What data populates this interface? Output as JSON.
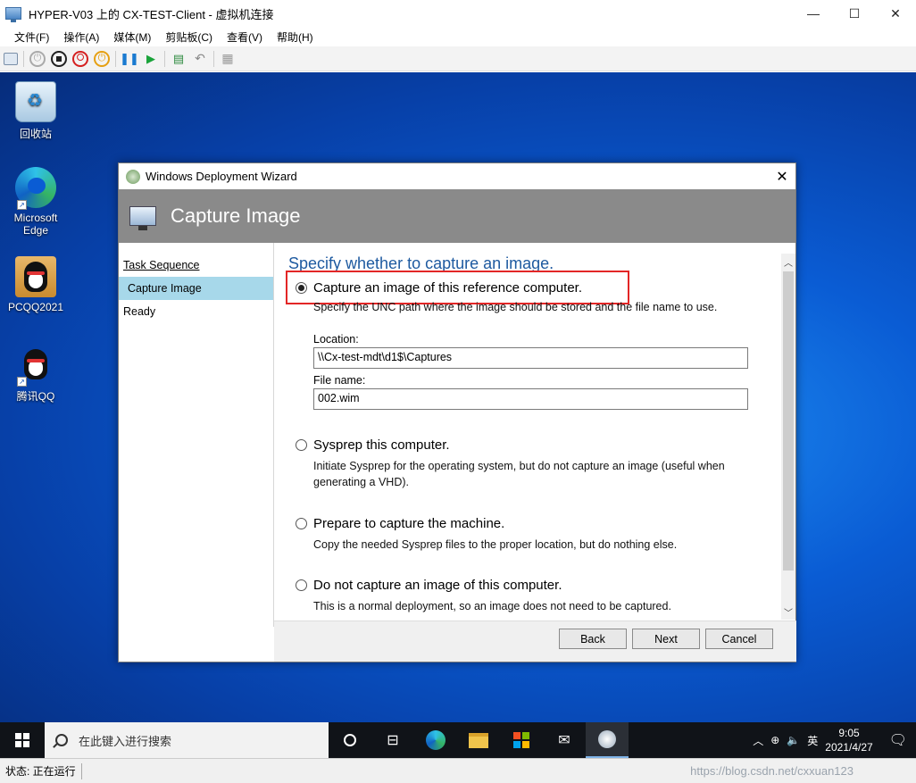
{
  "window": {
    "title": "HYPER-V03 上的 CX-TEST-Client - 虚拟机连接",
    "minimize": "—",
    "maximize": "☐",
    "close": "✕"
  },
  "menu": [
    "文件(F)",
    "操作(A)",
    "媒体(M)",
    "剪贴板(C)",
    "查看(V)",
    "帮助(H)"
  ],
  "desktop_icons": {
    "recycle_bin": "回收站",
    "edge": "Microsoft Edge",
    "pcqq": "PCQQ2021",
    "qq": "腾讯QQ"
  },
  "wizard": {
    "window_title": "Windows Deployment Wizard",
    "header_title": "Capture Image",
    "sidebar": [
      "Task Sequence",
      "Capture Image",
      "Ready"
    ],
    "heading": "Specify whether to capture an image.",
    "options": [
      {
        "label": "Capture an image of this reference computer.",
        "selected": true,
        "desc": "Specify the UNC path where the image should be stored and the file name to use."
      },
      {
        "label": "Sysprep this computer.",
        "selected": false,
        "desc": "Initiate Sysprep for the operating system, but do not capture an image (useful when generating a VHD)."
      },
      {
        "label": "Prepare to capture the machine.",
        "selected": false,
        "desc": "Copy the needed Sysprep files to the proper location, but do nothing else."
      },
      {
        "label": "Do not capture an image of this computer.",
        "selected": false,
        "desc": "This is a normal deployment, so an image does not need to be captured."
      }
    ],
    "location_label": "Location:",
    "location_value": "\\\\Cx-test-mdt\\d1$\\Captures",
    "filename_label": "File name:",
    "filename_value": "002.wim",
    "buttons": {
      "back": "Back",
      "next": "Next",
      "cancel": "Cancel"
    },
    "highlight_color": "#e32626"
  },
  "taskbar": {
    "search_placeholder": "在此键入进行搜索",
    "ime": "英",
    "time": "9:05",
    "date": "2021/4/27"
  },
  "status": {
    "text": "状态: 正在运行",
    "watermark": "https://blog.csdn.net/cxxuan123"
  },
  "colors": {
    "desktop": "#0a5cd4",
    "header": "#8a8a8a",
    "sidebar_active": "#a7d8ea",
    "heading": "#1e5aa0"
  }
}
